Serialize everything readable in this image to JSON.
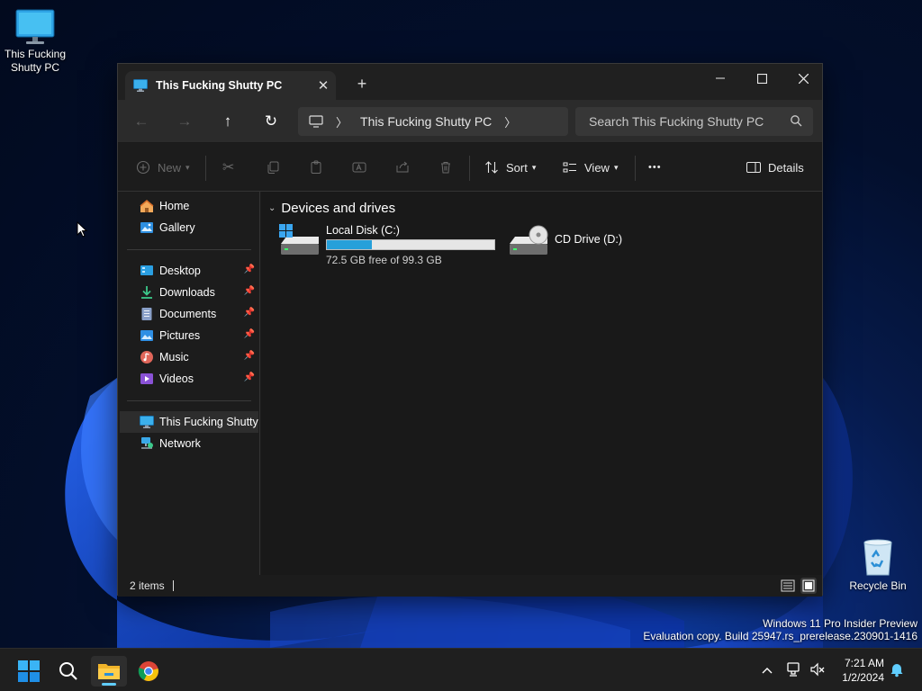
{
  "desktop": {
    "this_pc_label": "This Fucking Shutty PC",
    "recycle_bin_label": "Recycle Bin",
    "watermark_line1": "Windows 11 Pro Insider Preview",
    "watermark_line2": "Evaluation copy. Build 25947.rs_prerelease.230901-1416"
  },
  "window": {
    "tab_title": "This Fucking Shutty PC",
    "new_tab_symbol": "+",
    "minimize_icon": "minimize-icon",
    "maximize_icon": "maximize-icon",
    "close_icon": "close-icon"
  },
  "navigation": {
    "breadcrumb": [
      "This Fucking Shutty PC"
    ],
    "search_placeholder": "Search This Fucking Shutty PC"
  },
  "toolbar": {
    "new_label": "New",
    "sort_label": "Sort",
    "view_label": "View",
    "more_label": "•••",
    "details_label": "Details"
  },
  "sidebar": {
    "top": [
      {
        "label": "Home",
        "icon": "home-icon"
      },
      {
        "label": "Gallery",
        "icon": "gallery-icon"
      }
    ],
    "quick": [
      {
        "label": "Desktop",
        "icon": "desktop-folder-icon",
        "pinned": true
      },
      {
        "label": "Downloads",
        "icon": "downloads-icon",
        "pinned": true
      },
      {
        "label": "Documents",
        "icon": "documents-icon",
        "pinned": true
      },
      {
        "label": "Pictures",
        "icon": "pictures-icon",
        "pinned": true
      },
      {
        "label": "Music",
        "icon": "music-icon",
        "pinned": true
      },
      {
        "label": "Videos",
        "icon": "videos-icon",
        "pinned": true
      }
    ],
    "bottom": [
      {
        "label": "This Fucking Shutty PC",
        "icon": "computer-icon",
        "selected": true
      },
      {
        "label": "Network",
        "icon": "network-icon"
      }
    ]
  },
  "content": {
    "section_title": "Devices and drives",
    "drives": [
      {
        "name": "Local Disk (C:)",
        "free_text": "72.5 GB free of 99.3 GB",
        "used_fraction": 0.27
      },
      {
        "name": "CD Drive (D:)"
      }
    ]
  },
  "statusbar": {
    "item_count": "2 items"
  },
  "taskbar": {
    "time": "7:21 AM",
    "date": "1/2/2024",
    "accent": "#60cdff"
  }
}
